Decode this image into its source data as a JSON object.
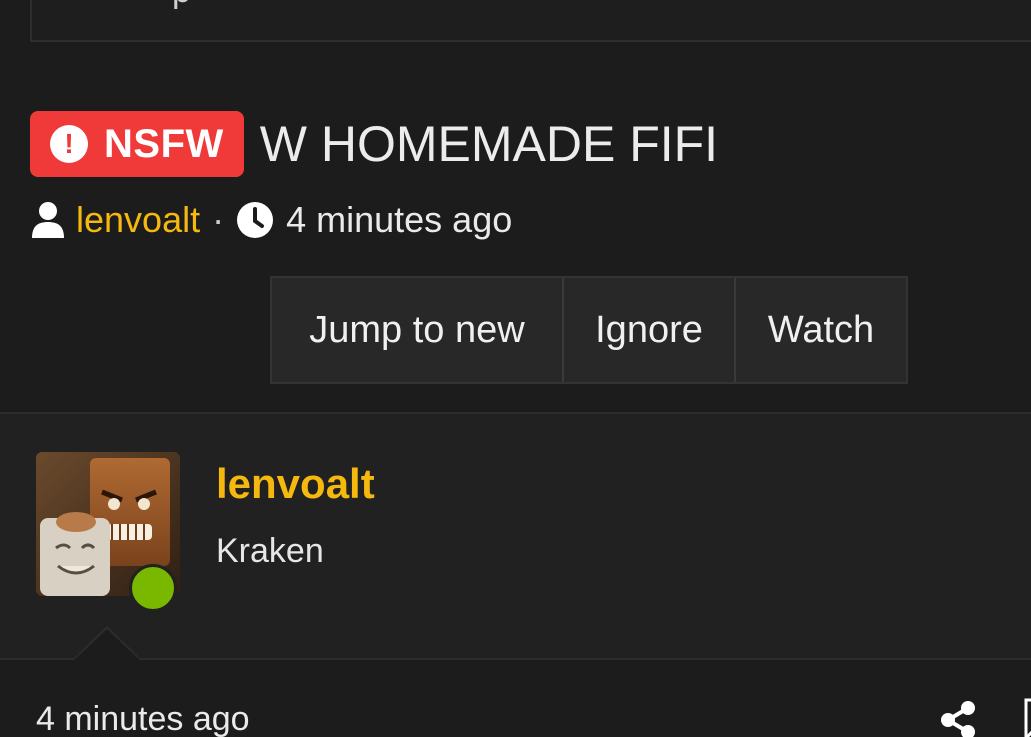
{
  "top_box": {
    "cut_text": "p"
  },
  "thread": {
    "prefix_badge": "NSFW",
    "prefix_icon": "exclamation-circle-icon",
    "title": "W HOMEMADE FIFI",
    "author": "lenvoalt",
    "separator": "·",
    "time": "4 minutes ago"
  },
  "actions": {
    "jump_label": "Jump to new",
    "ignore_label": "Ignore",
    "watch_label": "Watch"
  },
  "post": {
    "username": "lenvoalt",
    "user_title": "Kraken",
    "online_status": "online",
    "time": "4 minutes ago"
  },
  "colors": {
    "background": "#1c1c1c",
    "accent": "#f5b80f",
    "nsfw_badge": "#f03a3a",
    "online": "#7ab800"
  },
  "icons": {
    "user": "user-icon",
    "clock": "clock-icon",
    "share": "share-icon",
    "bookmark": "bookmark-icon"
  }
}
